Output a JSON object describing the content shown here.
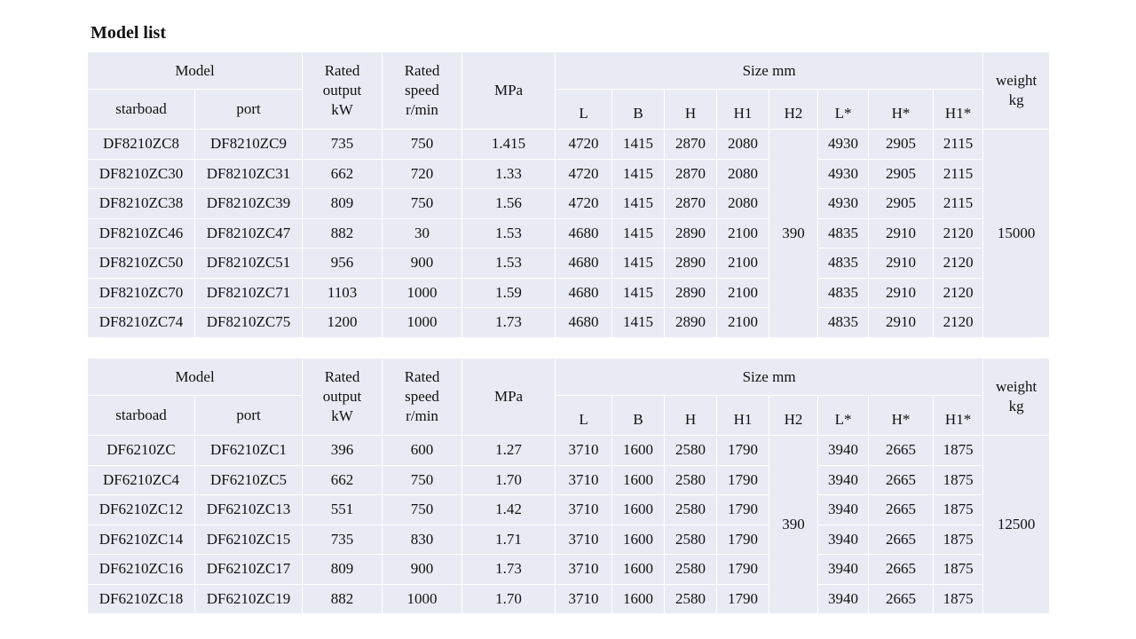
{
  "page": {
    "title": "Model list"
  },
  "header": {
    "model": "Model",
    "starboard": "starboad",
    "port": "port",
    "rated_output": [
      "Rated",
      "output",
      "kW"
    ],
    "rated_speed": [
      "Rated",
      "speed",
      "r/min"
    ],
    "mpa": "MPa",
    "size": "Size mm",
    "weight": [
      "weight",
      "kg"
    ],
    "size_cols": [
      "L",
      "B",
      "H",
      "H1",
      "H2",
      "L*",
      "H*",
      "H1*"
    ]
  },
  "tables": [
    {
      "h2": "390",
      "weight": "15000",
      "rows": [
        {
          "starboard": "DF8210ZC8",
          "port": "DF8210ZC9",
          "output": "735",
          "speed": "750",
          "mpa": "1.415",
          "L": "4720",
          "B": "1415",
          "H": "2870",
          "H1": "2080",
          "Ls": "4930",
          "Hs": "2905",
          "H1s": "2115"
        },
        {
          "starboard": "DF8210ZC30",
          "port": "DF8210ZC31",
          "output": "662",
          "speed": "720",
          "mpa": "1.33",
          "L": "4720",
          "B": "1415",
          "H": "2870",
          "H1": "2080",
          "Ls": "4930",
          "Hs": "2905",
          "H1s": "2115"
        },
        {
          "starboard": "DF8210ZC38",
          "port": "DF8210ZC39",
          "output": "809",
          "speed": "750",
          "mpa": "1.56",
          "L": "4720",
          "B": "1415",
          "H": "2870",
          "H1": "2080",
          "Ls": "4930",
          "Hs": "2905",
          "H1s": "2115"
        },
        {
          "starboard": "DF8210ZC46",
          "port": "DF8210ZC47",
          "output": "882",
          "speed": "30",
          "mpa": "1.53",
          "L": "4680",
          "B": "1415",
          "H": "2890",
          "H1": "2100",
          "Ls": "4835",
          "Hs": "2910",
          "H1s": "2120"
        },
        {
          "starboard": "DF8210ZC50",
          "port": "DF8210ZC51",
          "output": "956",
          "speed": "900",
          "mpa": "1.53",
          "L": "4680",
          "B": "1415",
          "H": "2890",
          "H1": "2100",
          "Ls": "4835",
          "Hs": "2910",
          "H1s": "2120"
        },
        {
          "starboard": "DF8210ZC70",
          "port": "DF8210ZC71",
          "output": "1103",
          "speed": "1000",
          "mpa": "1.59",
          "L": "4680",
          "B": "1415",
          "H": "2890",
          "H1": "2100",
          "Ls": "4835",
          "Hs": "2910",
          "H1s": "2120"
        },
        {
          "starboard": "DF8210ZC74",
          "port": "DF8210ZC75",
          "output": "1200",
          "speed": "1000",
          "mpa": "1.73",
          "L": "4680",
          "B": "1415",
          "H": "2890",
          "H1": "2100",
          "Ls": "4835",
          "Hs": "2910",
          "H1s": "2120"
        }
      ]
    },
    {
      "h2": "390",
      "weight": "12500",
      "rows": [
        {
          "starboard": "DF6210ZC",
          "port": "DF6210ZC1",
          "output": "396",
          "speed": "600",
          "mpa": "1.27",
          "L": "3710",
          "B": "1600",
          "H": "2580",
          "H1": "1790",
          "Ls": "3940",
          "Hs": "2665",
          "H1s": "1875"
        },
        {
          "starboard": "DF6210ZC4",
          "port": "DF6210ZC5",
          "output": "662",
          "speed": "750",
          "mpa": "1.70",
          "L": "3710",
          "B": "1600",
          "H": "2580",
          "H1": "1790",
          "Ls": "3940",
          "Hs": "2665",
          "H1s": "1875"
        },
        {
          "starboard": "DF6210ZC12",
          "port": "DF6210ZC13",
          "output": "551",
          "speed": "750",
          "mpa": "1.42",
          "L": "3710",
          "B": "1600",
          "H": "2580",
          "H1": "1790",
          "Ls": "3940",
          "Hs": "2665",
          "H1s": "1875"
        },
        {
          "starboard": "DF6210ZC14",
          "port": "DF6210ZC15",
          "output": "735",
          "speed": "830",
          "mpa": "1.71",
          "L": "3710",
          "B": "1600",
          "H": "2580",
          "H1": "1790",
          "Ls": "3940",
          "Hs": "2665",
          "H1s": "1875"
        },
        {
          "starboard": "DF6210ZC16",
          "port": "DF6210ZC17",
          "output": "809",
          "speed": "900",
          "mpa": "1.73",
          "L": "3710",
          "B": "1600",
          "H": "2580",
          "H1": "1790",
          "Ls": "3940",
          "Hs": "2665",
          "H1s": "1875"
        },
        {
          "starboard": "DF6210ZC18",
          "port": "DF6210ZC19",
          "output": "882",
          "speed": "1000",
          "mpa": "1.70",
          "L": "3710",
          "B": "1600",
          "H": "2580",
          "H1": "1790",
          "Ls": "3940",
          "Hs": "2665",
          "H1s": "1875"
        }
      ]
    }
  ]
}
